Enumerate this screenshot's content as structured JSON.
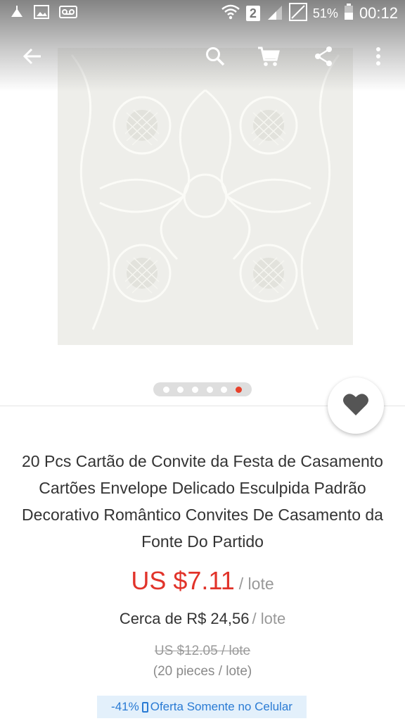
{
  "status_bar": {
    "sim": "2",
    "battery": "51%",
    "time": "00:12"
  },
  "toolbar": {
    "icons": [
      "back-arrow-icon",
      "search-icon",
      "cart-icon",
      "share-icon",
      "more-vert-icon"
    ]
  },
  "gallery": {
    "total": 6,
    "active_index": 5
  },
  "product": {
    "title": "20 Pcs Cartão de Convite da Festa de Casamento Cartões Envelope Delicado Esculpida Padrão Decorativo Romântico Convites De Casamento da Fonte Do Partido",
    "price": "US $7.11",
    "price_unit": "/ lote",
    "approx_price": "Cerca de R$ 24,56",
    "approx_unit": "/ lote",
    "original_price": "US $12.05 / lote",
    "pieces": "(20 pieces / lote)",
    "discount": "-41%",
    "promo_text": "Oferta Somente no Celular"
  },
  "colors": {
    "price": "#e1332a",
    "accent_dot": "#e8402a",
    "promo_text": "#2a7bd4",
    "promo_bg": "#e3f0fb"
  }
}
